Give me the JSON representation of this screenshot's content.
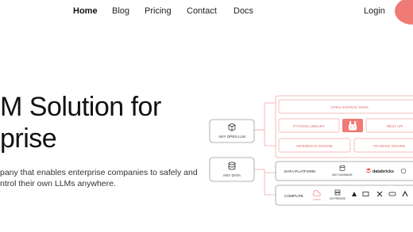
{
  "nav": {
    "items": [
      {
        "label": "Home",
        "active": true
      },
      {
        "label": "Blog",
        "active": false
      },
      {
        "label": "Pricing",
        "active": false
      },
      {
        "label": "Contact",
        "active": false
      },
      {
        "label": "Docs",
        "active": false
      }
    ],
    "login": "Login"
  },
  "hero": {
    "title_line1": "M Solution for",
    "title_line2": "prise",
    "subtitle_line1": "pany that enables enterprise companies to safely and",
    "subtitle_line2": "ntrol their own LLMs anywhere."
  },
  "diagram": {
    "open_llm": "ANY OPEN LLM",
    "any_data": "ANY DATA",
    "open_source_sdks": "OPEN SOURCE SDKS",
    "python_library": "PYTHON LIBRARY",
    "rest_api": "REST API",
    "inference_engine": "INFERENCE ENGINE",
    "training_engine": "TRAINING ENGINE",
    "data_platform": "DATA PLATFORM",
    "any_database": "ANY DATABASE",
    "databricks": "databricks",
    "compute": "COMPUTE",
    "on_premise": "ON PREMISE",
    "cloud_label": "LAMINI"
  },
  "colors": {
    "accent": "#f07a76",
    "accent_light": "#f9c9c6",
    "box_border": "#9a9a9a"
  }
}
